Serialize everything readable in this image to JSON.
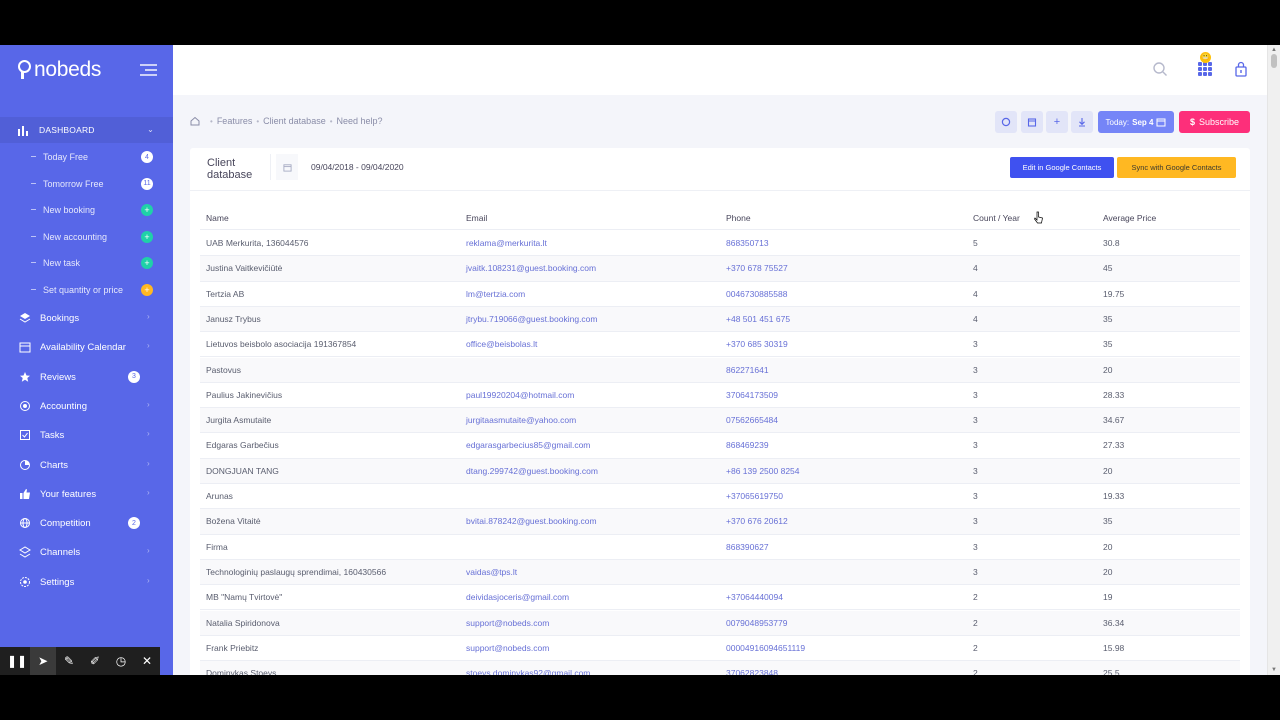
{
  "app": {
    "name": "nobeds"
  },
  "colors": {
    "sidebar": "#5867e8",
    "accent": "#3f51f0",
    "subscribe": "#fd2f7a",
    "sync": "#ffb822",
    "teal_badge": "#1fd1a8"
  },
  "sidebar": {
    "dashboard": {
      "label": "DASHBOARD",
      "icon": "bar-chart-icon"
    },
    "sub_items": [
      {
        "label": "Today Free",
        "badge": "4",
        "badge_style": "white"
      },
      {
        "label": "Tomorrow Free",
        "badge": "11",
        "badge_style": "white"
      },
      {
        "label": "New booking",
        "badge": "+",
        "badge_style": "teal"
      },
      {
        "label": "New accounting",
        "badge": "+",
        "badge_style": "teal"
      },
      {
        "label": "New task",
        "badge": "+",
        "badge_style": "teal"
      },
      {
        "label": "Set quantity or price",
        "badge": "+",
        "badge_style": "orange"
      }
    ],
    "main_items": [
      {
        "label": "Bookings",
        "icon": "layers-icon",
        "chevron": "›"
      },
      {
        "label": "Availability Calendar",
        "icon": "calendar-icon",
        "chevron": "›"
      },
      {
        "label": "Reviews",
        "icon": "star-icon",
        "badge": "3"
      },
      {
        "label": "Accounting",
        "icon": "coins-icon",
        "chevron": "›"
      },
      {
        "label": "Tasks",
        "icon": "tasks-icon",
        "chevron": "›"
      },
      {
        "label": "Charts",
        "icon": "pie-chart-icon",
        "chevron": "›"
      },
      {
        "label": "Your features",
        "icon": "thumbs-up-icon",
        "chevron": "›"
      },
      {
        "label": "Competition",
        "icon": "globe-icon",
        "badge": "2"
      },
      {
        "label": "Channels",
        "icon": "channels-icon",
        "chevron": "›"
      },
      {
        "label": "Settings",
        "icon": "settings-icon",
        "chevron": "›"
      }
    ]
  },
  "header": {
    "emoji": "😬"
  },
  "breadcrumb": [
    "Features",
    "Client database",
    "Need help?"
  ],
  "toolbar": {
    "today_label": "Today:",
    "today_value": "Sep 4",
    "subscribe_label": "Subscribe",
    "subscribe_symbol": "$"
  },
  "card": {
    "title": "Client database",
    "date_range": "09/04/2018 - 09/04/2020",
    "edit_button": "Edit in Google Contacts",
    "sync_button": "Sync with Google Contacts"
  },
  "table": {
    "columns": [
      "Name",
      "Email",
      "Phone",
      "Count / Year",
      "Average Price"
    ],
    "rows": [
      [
        "UAB Merkurita, 136044576",
        "reklama@merkurita.lt",
        "868350713",
        "5",
        "30.8"
      ],
      [
        "Justina Vaitkevičiūtė",
        "jvaitk.108231@guest.booking.com",
        "+370 678 75527",
        "4",
        "45"
      ],
      [
        "Tertzia AB",
        "lm@tertzia.com",
        "0046730885588",
        "4",
        "19.75"
      ],
      [
        "Janusz Trybus",
        "jtrybu.719066@guest.booking.com",
        "+48 501 451 675",
        "4",
        "35"
      ],
      [
        "Lietuvos beisbolo asociacija 191367854",
        "office@beisbolas.lt",
        "+370 685 30319",
        "3",
        "35"
      ],
      [
        "Pastovus",
        "",
        "862271641",
        "3",
        "20"
      ],
      [
        "Paulius Jakinevičius",
        "paul19920204@hotmail.com",
        "37064173509",
        "3",
        "28.33"
      ],
      [
        "Jurgita Asmutaite",
        "jurgitaasmutaite@yahoo.com",
        "07562665484",
        "3",
        "34.67"
      ],
      [
        "Edgaras Garbečius",
        "edgarasgarbecius85@gmail.com",
        "868469239",
        "3",
        "27.33"
      ],
      [
        "DONGJUAN TANG",
        "dtang.299742@guest.booking.com",
        "+86 139 2500 8254",
        "3",
        "20"
      ],
      [
        "Arunas",
        "",
        "+37065619750",
        "3",
        "19.33"
      ],
      [
        "Božena Vitaitė",
        "bvitai.878242@guest.booking.com",
        "+370 676 20612",
        "3",
        "35"
      ],
      [
        "Firma",
        "",
        "868390627",
        "3",
        "20"
      ],
      [
        "Technologinių paslaugų sprendimai, 160430566",
        "vaidas@tps.lt",
        "",
        "3",
        "20"
      ],
      [
        "MB \"Namų Tvirtovė\"",
        "deividasjoceris@gmail.com",
        "+37064440094",
        "2",
        "19"
      ],
      [
        "Natalia Spiridonova",
        "support@nobeds.com",
        "0079048953779",
        "2",
        "36.34"
      ],
      [
        "Frank Priebitz",
        "support@nobeds.com",
        "00004916094651119",
        "2",
        "15.98"
      ],
      [
        "Dominykas Stoeys",
        "stoeys.dominykas92@gmail.com",
        "37062823848",
        "2",
        "25.5"
      ]
    ]
  },
  "recorder": {
    "icons": [
      "pause-icon",
      "pointer-icon",
      "pen-icon",
      "highlighter-icon",
      "timer-icon",
      "close-icon"
    ]
  }
}
